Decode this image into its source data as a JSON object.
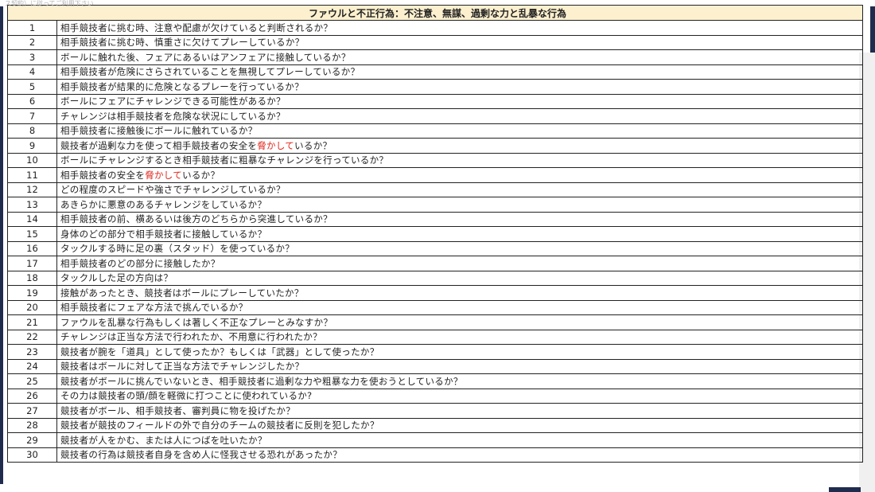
{
  "overlay_text": [
    "ス契約）に従ってご利用下さい"
  ],
  "table": {
    "title": "ファウルと不正行為：不注意、無謀、過剰な力と乱暴な行為",
    "rows": [
      {
        "num": "1",
        "text": "相手競技者に挑む時、注意や配慮が欠けていると判断されるか？"
      },
      {
        "num": "2",
        "text": "相手競技者に挑む時、慎重さに欠けてプレーしているか？"
      },
      {
        "num": "3",
        "text": "ボールに触れた後、フェアにあるいはアンフェアに接触しているか？"
      },
      {
        "num": "4",
        "text": "相手競技者が危険にさらされていることを無視してプレーしているか？"
      },
      {
        "num": "5",
        "text": "相手競技者が結果的に危険となるプレーを行っているか？"
      },
      {
        "num": "6",
        "text": "ボールにフェアにチャレンジできる可能性があるか？"
      },
      {
        "num": "7",
        "text": "チャレンジは相手競技者を危険な状況にしているか？"
      },
      {
        "num": "8",
        "text": "相手競技者に接触後にボールに触れているか？"
      },
      {
        "num": "9",
        "text_before": "競技者が過剰な力を使って相手競技者の安全を",
        "text_hl": "脅かして",
        "text_after": "いるか？"
      },
      {
        "num": "10",
        "text": "ボールにチャレンジするとき相手競技者に粗暴なチャレンジを行っているか？"
      },
      {
        "num": "11",
        "text_before": "相手競技者の安全を",
        "text_hl": "脅かして",
        "text_after": "いるか？"
      },
      {
        "num": "12",
        "text": "どの程度のスピードや強さでチャレンジしているか？"
      },
      {
        "num": "13",
        "text": "あきらかに悪意のあるチャレンジをしているか？"
      },
      {
        "num": "14",
        "text": "相手競技者の前、横あるいは後方のどちらから突進しているか？"
      },
      {
        "num": "15",
        "text": "身体のどの部分で相手競技者に接触しているか？"
      },
      {
        "num": "16",
        "text": "タックルする時に足の裏（スタッド）を使っているか？"
      },
      {
        "num": "17",
        "text": "相手競技者のどの部分に接触したか？"
      },
      {
        "num": "18",
        "text": "タックルした足の方向は？"
      },
      {
        "num": "19",
        "text": "接触があったとき、競技者はボールにプレーしていたか？"
      },
      {
        "num": "20",
        "text": "相手競技者にフェアな方法で挑んでいるか？"
      },
      {
        "num": "21",
        "text": "ファウルを乱暴な行為もしくは著しく不正なプレーとみなすか？"
      },
      {
        "num": "22",
        "text": "チャレンジは正当な方法で行われたか、不用意に行われたか？"
      },
      {
        "num": "23",
        "text": "競技者が腕を「道具」として使ったか？もしくは「武器」として使ったか？"
      },
      {
        "num": "24",
        "text": "競技者はボールに対して正当な方法でチャレンジしたか？"
      },
      {
        "num": "25",
        "text": "競技者がボールに挑んでいないとき、相手競技者に過剰な力や粗暴な力を使おうとしているか？"
      },
      {
        "num": "26",
        "text": "その力は競技者の頭/顔を軽微に打つことに使われているか?"
      },
      {
        "num": "27",
        "text": "競技者がボール、相手競技者、審判員に物を投げたか？"
      },
      {
        "num": "28",
        "text": "競技者が競技のフィールドの外で自分のチームの競技者に反則を犯したか？"
      },
      {
        "num": "29",
        "text": "競技者が人をかむ、または人につばを吐いたか？"
      },
      {
        "num": "30",
        "text": "競技者の行為は競技者自身を含め人に怪我させる恐れがあったか？"
      }
    ]
  },
  "colors": {
    "header_bg": "#fcf0cf",
    "highlight": "#e0251b",
    "frame": "#1f2c4d"
  }
}
